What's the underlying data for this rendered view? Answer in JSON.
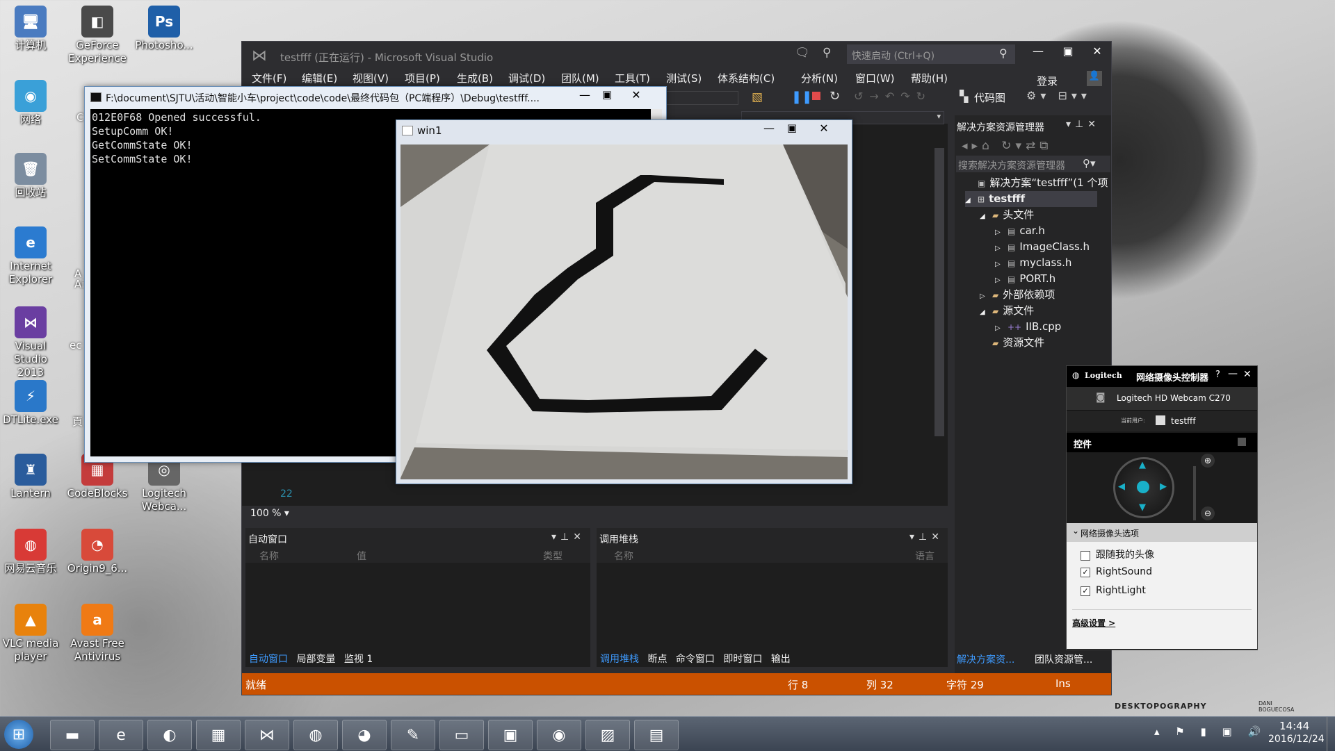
{
  "desktop": {
    "icons": [
      {
        "label": "计算机",
        "glyph": "🖥",
        "color": "#4a7bc0"
      },
      {
        "label": "GeForce Experience",
        "glyph": "◧",
        "color": "#4a4a4a"
      },
      {
        "label": "Photosho...",
        "glyph": "Ps",
        "color": "#1f5fa8"
      },
      {
        "label": "网络",
        "glyph": "◉",
        "color": "#3aa0d8"
      },
      {
        "label": "回收站",
        "glyph": "🗑",
        "color": "#7c8da0"
      },
      {
        "label": "Internet Explorer",
        "glyph": "e",
        "color": "#2b7bd0"
      },
      {
        "label": "Visual Studio 2013",
        "glyph": "⋈",
        "color": "#6a3ea1"
      },
      {
        "label": "DTLite.exe",
        "glyph": "⚡",
        "color": "#2a78c9"
      },
      {
        "label": "Lantern",
        "glyph": "♜",
        "color": "#2a5c9c"
      },
      {
        "label": "CodeBlocks",
        "glyph": "▦",
        "color": "#c43c3c"
      },
      {
        "label": "Logitech Webca...",
        "glyph": "◎",
        "color": "#666"
      },
      {
        "label": "网易云音乐",
        "glyph": "◍",
        "color": "#d83a36"
      },
      {
        "label": "Origin9_6...",
        "glyph": "◔",
        "color": "#d84a3a"
      },
      {
        "label": "VLC media player",
        "glyph": "▲",
        "color": "#e8820c"
      },
      {
        "label": "Avast Free Antivirus",
        "glyph": "a",
        "color": "#f07a15"
      }
    ],
    "partial_labels": [
      "C",
      "A",
      "Ai",
      "ec",
      "頁",
      "iI"
    ],
    "watermark": "DESKTOPOGRAPHY",
    "watermark2": "DANI BOGUECOSA"
  },
  "vs": {
    "title": "testfff (正在运行) - Microsoft Visual Studio",
    "quick_launch_placeholder": "快速启动 (Ctrl+Q)",
    "menu": [
      "文件(F)",
      "编辑(E)",
      "视图(V)",
      "项目(P)",
      "生成(B)",
      "调试(D)",
      "团队(M)",
      "工具(T)",
      "测试(S)",
      "体系结构(C)",
      "分析(N)",
      "窗口(W)",
      "帮助(H)"
    ],
    "login": "登录",
    "code_map": "代码图",
    "line_number": "22",
    "zoom": "100 %",
    "solution_explorer": {
      "title": "解决方案资源管理器",
      "search_placeholder": "搜索解决方案资源管理器",
      "items": [
        {
          "text": "解决方案“testfff”(1 个项",
          "icon": "▣"
        },
        {
          "text": "testfff",
          "icon": "⊞"
        },
        {
          "text": "头文件",
          "icon": "▰"
        },
        {
          "text": "car.h",
          "icon": "▤"
        },
        {
          "text": "ImageClass.h",
          "icon": "▤"
        },
        {
          "text": "myclass.h",
          "icon": "▤"
        },
        {
          "text": "PORT.h",
          "icon": "▤"
        },
        {
          "text": "外部依赖项",
          "icon": "▰"
        },
        {
          "text": "源文件",
          "icon": "▰"
        },
        {
          "text": "IIB.cpp",
          "icon": "++"
        },
        {
          "text": "资源文件",
          "icon": "▰"
        }
      ],
      "tabs": [
        "解决方案资...",
        "团队资源管..."
      ]
    },
    "auto_window": {
      "title": "自动窗口",
      "columns": [
        "名称",
        "值",
        "类型"
      ],
      "tabs": [
        "自动窗口",
        "局部变量",
        "监视 1"
      ]
    },
    "call_stack": {
      "title": "调用堆栈",
      "columns": [
        "名称",
        "语言"
      ],
      "tabs": [
        "调用堆栈",
        "断点",
        "命令窗口",
        "即时窗口",
        "输出"
      ]
    },
    "status": {
      "ready": "就绪",
      "line": "行 8",
      "col": "列 32",
      "char": "字符 29",
      "mode": "Ins"
    }
  },
  "console": {
    "title": "F:\\document\\SJTU\\活动\\智能小车\\project\\code\\code\\最终代码包（PC端程序）\\Debug\\testfff....",
    "lines": [
      "012E0F68 Opened successful.",
      "SetupComm OK!",
      "GetCommState OK!",
      "SetCommState OK!"
    ]
  },
  "win1": {
    "title": "win1"
  },
  "logitech": {
    "brand": "Logitech",
    "title": "网络摄像头控制器",
    "device": "Logitech HD Webcam C270",
    "user_label": "当前用户:",
    "user": "testfff",
    "controls": "控件",
    "options_header": "网络摄像头选项",
    "options": [
      {
        "label": "跟随我的头像",
        "checked": false
      },
      {
        "label": "RightSound",
        "checked": true
      },
      {
        "label": "RightLight",
        "checked": true
      }
    ],
    "advanced": "高级设置 >"
  },
  "taskbar": {
    "apps": [
      {
        "name": "start",
        "glyph": "⊞"
      },
      {
        "name": "explorer",
        "glyph": "▬"
      },
      {
        "name": "ie",
        "glyph": "e"
      },
      {
        "name": "eclipse",
        "glyph": "◐"
      },
      {
        "name": "windows-app",
        "glyph": "▦"
      },
      {
        "name": "visual-studio",
        "glyph": "⋈"
      },
      {
        "name": "netease-music",
        "glyph": "◍"
      },
      {
        "name": "github",
        "glyph": "◕"
      },
      {
        "name": "paint",
        "glyph": "✎"
      },
      {
        "name": "cmd",
        "glyph": "▭"
      },
      {
        "name": "remote-desktop",
        "glyph": "▣"
      },
      {
        "name": "webcam",
        "glyph": "◉"
      },
      {
        "name": "photo-viewer",
        "glyph": "▨"
      },
      {
        "name": "win1-opencv",
        "glyph": "▤"
      }
    ],
    "time": "14:44",
    "date": "2016/12/24"
  }
}
